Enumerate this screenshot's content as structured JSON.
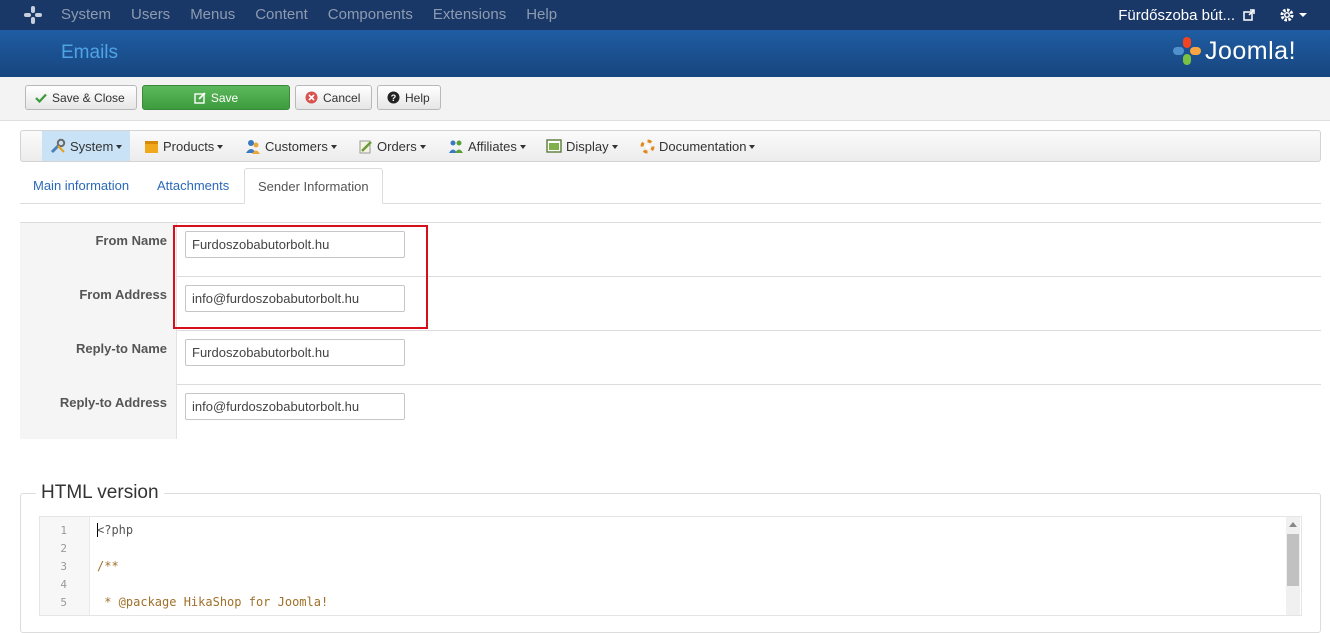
{
  "topbar": {
    "menu": [
      "System",
      "Users",
      "Menus",
      "Content",
      "Components",
      "Extensions",
      "Help"
    ],
    "site_name": "Fürdőszoba bút...",
    "icons": [
      "joomla-icon",
      "external-link-icon",
      "gear-icon"
    ]
  },
  "header": {
    "title": "Emails",
    "brand": "Joomla!"
  },
  "toolbar": {
    "save_close": "Save & Close",
    "save": "Save",
    "cancel": "Cancel",
    "help": "Help"
  },
  "hikamenu": {
    "items": [
      {
        "label": "System",
        "icon": "wrench-icon"
      },
      {
        "label": "Products",
        "icon": "box-icon"
      },
      {
        "label": "Customers",
        "icon": "users-icon"
      },
      {
        "label": "Orders",
        "icon": "pencil-icon"
      },
      {
        "label": "Affiliates",
        "icon": "affiliates-icon"
      },
      {
        "label": "Display",
        "icon": "display-icon"
      },
      {
        "label": "Documentation",
        "icon": "lifebuoy-icon"
      }
    ]
  },
  "tabs": [
    "Main information",
    "Attachments",
    "Sender Information"
  ],
  "form": {
    "from_name": {
      "label": "From Name",
      "value": "Furdoszobabutorbolt.hu"
    },
    "from_address": {
      "label": "From Address",
      "value": "info@furdoszobabutorbolt.hu"
    },
    "reply_name": {
      "label": "Reply-to Name",
      "value": "Furdoszobabutorbolt.hu"
    },
    "reply_address": {
      "label": "Reply-to Address",
      "value": "info@furdoszobabutorbolt.hu"
    }
  },
  "html_version": {
    "legend": "HTML version",
    "line_numbers": [
      "1",
      "2",
      "3",
      "4",
      "5"
    ],
    "lines": [
      "<?php",
      "",
      "/**",
      "",
      " * @package HikaShop for Joomla!"
    ]
  },
  "colors": {
    "topbar": "#1a3867",
    "header": "#1f5da3",
    "save_button": "#5cb85c",
    "highlight": "#d6101a",
    "link": "#2a69b8"
  }
}
